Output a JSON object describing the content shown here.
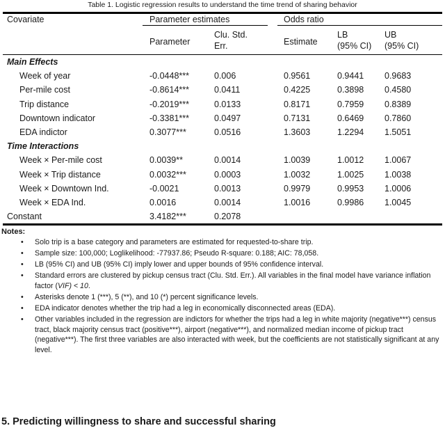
{
  "table": {
    "caption": "Table 1. Logistic regression results to understand the time trend of sharing behavior",
    "headers": {
      "covariate": "Covariate",
      "group_parameter_estimates": "Parameter estimates",
      "group_odds_ratio": "Odds ratio",
      "parameter": "Parameter",
      "clu_std_err_line1": "Clu. Std.",
      "clu_std_err_line2": "Err.",
      "estimate": "Estimate",
      "lb_line1": "LB",
      "lb_line2": "(95% CI)",
      "ub_line1": "UB",
      "ub_line2": "(95% CI)"
    },
    "sections": [
      {
        "title": "Main Effects",
        "rows": [
          {
            "label": "Week of year",
            "parameter": "-0.0448***",
            "std_err": "0.006",
            "estimate": "0.9561",
            "lb": "0.9441",
            "ub": "0.9683"
          },
          {
            "label": "Per-mile cost",
            "parameter": "-0.8614***",
            "std_err": "0.0411",
            "estimate": "0.4225",
            "lb": "0.3898",
            "ub": "0.4580"
          },
          {
            "label": "Trip distance",
            "parameter": "-0.2019***",
            "std_err": "0.0133",
            "estimate": "0.8171",
            "lb": "0.7959",
            "ub": "0.8389"
          },
          {
            "label": "Downtown indicator",
            "parameter": "-0.3381***",
            "std_err": "0.0497",
            "estimate": "0.7131",
            "lb": "0.6469",
            "ub": "0.7860"
          },
          {
            "label": "EDA indictor",
            "parameter": "0.3077***",
            "std_err": "0.0516",
            "estimate": "1.3603",
            "lb": "1.2294",
            "ub": "1.5051"
          }
        ]
      },
      {
        "title": "Time Interactions",
        "rows": [
          {
            "label": "Week × Per-mile cost",
            "parameter": "0.0039**",
            "std_err": "0.0014",
            "estimate": "1.0039",
            "lb": "1.0012",
            "ub": "1.0067"
          },
          {
            "label": "Week × Trip distance",
            "parameter": "0.0032***",
            "std_err": "0.0003",
            "estimate": "1.0032",
            "lb": "1.0025",
            "ub": "1.0038"
          },
          {
            "label": "Week × Downtown Ind.",
            "parameter": "-0.0021",
            "std_err": "0.0013",
            "estimate": "0.9979",
            "lb": "0.9953",
            "ub": "1.0006"
          },
          {
            "label": "Week × EDA Ind.",
            "parameter": "0.0016",
            "std_err": "0.0014",
            "estimate": "1.0016",
            "lb": "0.9986",
            "ub": "1.0045"
          }
        ]
      }
    ],
    "constant_row": {
      "label": "Constant",
      "parameter": "3.4182***",
      "std_err": "0.2078",
      "estimate": "",
      "lb": "",
      "ub": ""
    }
  },
  "notes": {
    "title": "Notes:",
    "bullet_glyph": "•",
    "items": [
      "Solo trip is a base category and parameters are estimated for requested-to-share trip.",
      "Sample size: 100,000; Loglikelihood: -77937.86; Pseudo R-square: 0.188; AIC: 78,058.",
      "LB (95% CI) and UB (95% CI) imply lower and upper bounds of 95% confidence interval.",
      "Standard errors are clustered by pickup census tract (Clu. Std. Err.). All variables in the final model have variance inflation factor (VIF) < 10.",
      "Asterisks denote 1 (***), 5 (**), and 10 (*) percent significance levels.",
      "EDA indicator denotes whether the trip had a leg in economically disconnected areas (EDA).",
      "Other variables included in the regression are indictors for whether the trips had a leg in white majority (negative***) census tract, black majority census tract (positive***), airport (negative***), and normalized median income of pickup tract (negative***). The first three variables are also interacted with week, but the coefficients are not statistically significant at any level."
    ],
    "italic_fragment": "VIF) < 10"
  },
  "section_heading": "5. Predicting willingness to share and successful sharing"
}
